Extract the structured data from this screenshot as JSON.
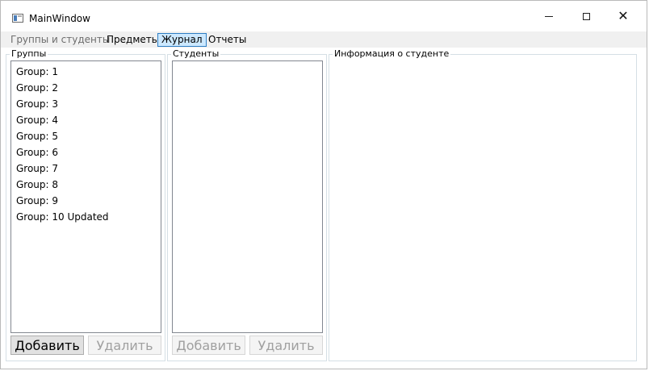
{
  "window": {
    "title": "MainWindow"
  },
  "menu": {
    "tabs": [
      {
        "label": "Группы и студенты"
      },
      {
        "label": "Предметы"
      },
      {
        "label": "Журнал"
      },
      {
        "label": "Отчеты"
      }
    ],
    "active_tab": "Журнал"
  },
  "groups": {
    "legend": "Группы",
    "items": [
      "Group: 1",
      "Group: 2",
      "Group: 3",
      "Group: 4",
      "Group: 5",
      "Group: 6",
      "Group: 7",
      "Group: 8",
      "Group: 9",
      "Group: 10 Updated"
    ],
    "add_label": "Добавить",
    "delete_label": "Удалить"
  },
  "students": {
    "legend": "Студенты",
    "items": [],
    "add_label": "Добавить",
    "delete_label": "Удалить"
  },
  "student_info": {
    "legend": "Информация о студенте"
  },
  "colors": {
    "accent": "#cce8ff",
    "accent_border": "#2f7fc4",
    "menubar_bg": "#f0f0f0"
  }
}
